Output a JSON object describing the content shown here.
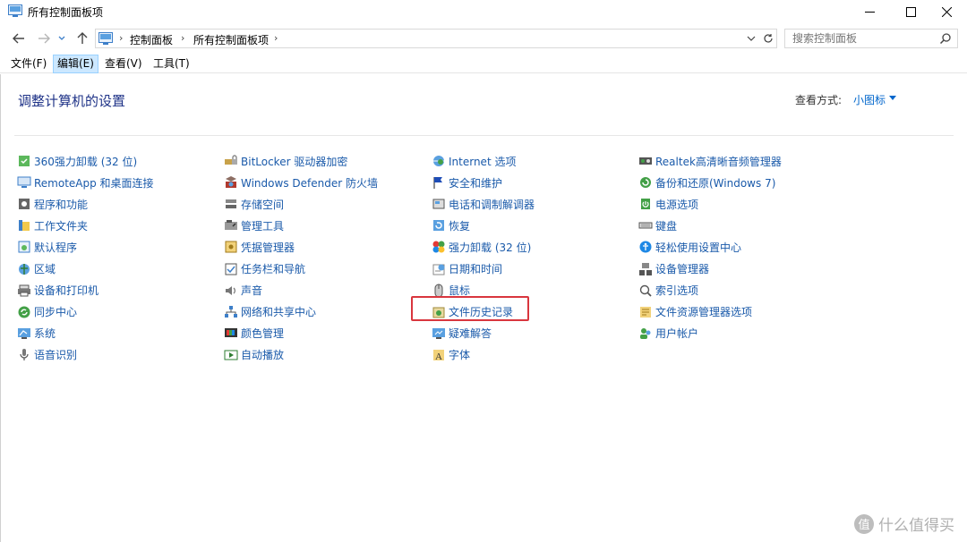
{
  "window": {
    "title": "所有控制面板项",
    "controls": {
      "minimize": "─",
      "maximize": "☐",
      "close": "✕"
    }
  },
  "nav": {
    "back": "←",
    "forward": "→",
    "recent": "⌄",
    "up": "↑",
    "breadcrumb": [
      "控制面板",
      "所有控制面板项"
    ],
    "separator": "›",
    "search_placeholder": "搜索控制面板"
  },
  "menu": [
    {
      "label": "文件(F)"
    },
    {
      "label": "编辑(E)",
      "active": true
    },
    {
      "label": "查看(V)"
    },
    {
      "label": "工具(T)"
    }
  ],
  "content": {
    "heading": "调整计算机的设置",
    "view_label": "查看方式:",
    "view_value": "小图标",
    "highlighted_item": "文件历史记录"
  },
  "columns": [
    [
      {
        "label": "360强力卸载 (32 位)",
        "icon": "uninstall-icon"
      },
      {
        "label": "RemoteApp 和桌面连接",
        "icon": "remote-desktop-icon"
      },
      {
        "label": "程序和功能",
        "icon": "programs-icon"
      },
      {
        "label": "工作文件夹",
        "icon": "work-folder-icon"
      },
      {
        "label": "默认程序",
        "icon": "default-programs-icon"
      },
      {
        "label": "区域",
        "icon": "region-icon"
      },
      {
        "label": "设备和打印机",
        "icon": "printer-icon"
      },
      {
        "label": "同步中心",
        "icon": "sync-icon"
      },
      {
        "label": "系统",
        "icon": "system-icon"
      },
      {
        "label": "语音识别",
        "icon": "microphone-icon"
      }
    ],
    [
      {
        "label": "BitLocker 驱动器加密",
        "icon": "bitlocker-icon"
      },
      {
        "label": "Windows Defender 防火墙",
        "icon": "firewall-icon"
      },
      {
        "label": "存储空间",
        "icon": "storage-icon"
      },
      {
        "label": "管理工具",
        "icon": "admin-tools-icon"
      },
      {
        "label": "凭据管理器",
        "icon": "credential-icon"
      },
      {
        "label": "任务栏和导航",
        "icon": "taskbar-icon"
      },
      {
        "label": "声音",
        "icon": "speaker-icon"
      },
      {
        "label": "网络和共享中心",
        "icon": "network-icon"
      },
      {
        "label": "颜色管理",
        "icon": "color-icon"
      },
      {
        "label": "自动播放",
        "icon": "autoplay-icon"
      }
    ],
    [
      {
        "label": "Internet 选项",
        "icon": "internet-icon"
      },
      {
        "label": "安全和维护",
        "icon": "flag-icon"
      },
      {
        "label": "电话和调制解调器",
        "icon": "phone-icon"
      },
      {
        "label": "恢复",
        "icon": "recovery-icon"
      },
      {
        "label": "强力卸载 (32 位)",
        "icon": "uninstall-color-icon"
      },
      {
        "label": "日期和时间",
        "icon": "clock-icon"
      },
      {
        "label": "鼠标",
        "icon": "mouse-icon"
      },
      {
        "label": "文件历史记录",
        "icon": "file-history-icon"
      },
      {
        "label": "疑难解答",
        "icon": "troubleshoot-icon"
      },
      {
        "label": "字体",
        "icon": "font-icon"
      }
    ],
    [
      {
        "label": "Realtek高清晰音频管理器",
        "icon": "audio-manager-icon"
      },
      {
        "label": "备份和还原(Windows 7)",
        "icon": "backup-icon"
      },
      {
        "label": "电源选项",
        "icon": "power-icon"
      },
      {
        "label": "键盘",
        "icon": "keyboard-icon"
      },
      {
        "label": "轻松使用设置中心",
        "icon": "accessibility-icon"
      },
      {
        "label": "设备管理器",
        "icon": "device-manager-icon"
      },
      {
        "label": "索引选项",
        "icon": "index-icon"
      },
      {
        "label": "文件资源管理器选项",
        "icon": "explorer-options-icon"
      },
      {
        "label": "用户帐户",
        "icon": "user-accounts-icon"
      }
    ]
  ],
  "watermark": {
    "badge": "值",
    "text": "什么值得买"
  },
  "colors": {
    "link": "#1a5aaa",
    "heading": "#1e3287",
    "highlight": "#d9363e"
  }
}
